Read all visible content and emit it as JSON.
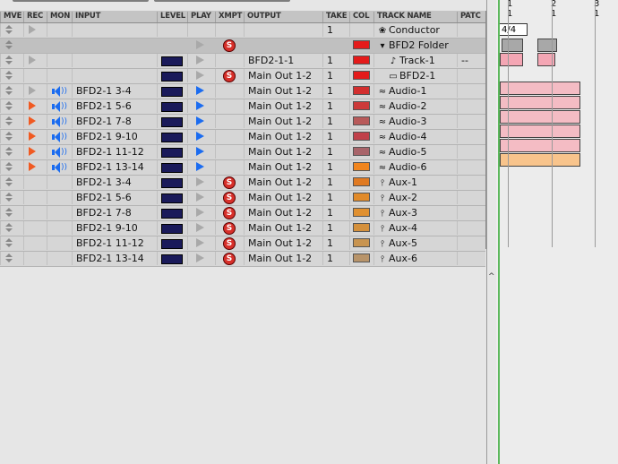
{
  "headers": [
    "MVE",
    "REC",
    "MON",
    "INPUT",
    "LEVEL",
    "PLAY",
    "XMPT",
    "OUTPUT",
    "TAKE",
    "COL",
    "TRACK NAME",
    "PATC"
  ],
  "tracks": [
    {
      "rec": "off",
      "mon": false,
      "input": "",
      "level": false,
      "play": "none",
      "xmpt": false,
      "output": "",
      "take": "1",
      "color": "",
      "icon": "conductor-icon",
      "glyph": "❀",
      "name": "Conductor",
      "patch": "",
      "sel": false
    },
    {
      "rec": "none",
      "mon": false,
      "input": "",
      "level": false,
      "play": "off",
      "xmpt": true,
      "output": "",
      "take": "",
      "color": "#e41b1b",
      "icon": "folder-triangle-icon",
      "glyph": "▾",
      "name": "BFD2 Folder",
      "patch": "",
      "sel": true
    },
    {
      "rec": "off",
      "mon": false,
      "input": "",
      "level": true,
      "play": "off",
      "xmpt": false,
      "output": "BFD2-1-1",
      "take": "1",
      "color": "#e41b1b",
      "icon": "midi-note-icon",
      "glyph": "♪",
      "name": "Track-1",
      "patch": "--",
      "sel": false
    },
    {
      "rec": "none",
      "mon": false,
      "input": "",
      "level": true,
      "play": "off",
      "xmpt": true,
      "output": "Main Out 1-2",
      "take": "1",
      "color": "#e41b1b",
      "icon": "instrument-icon",
      "glyph": "▭",
      "name": "BFD2-1",
      "patch": "",
      "sel": false
    },
    {
      "rec": "off",
      "mon": true,
      "input": "BFD2-1 3-4",
      "level": true,
      "play": "on",
      "xmpt": false,
      "output": "Main Out 1-2",
      "take": "1",
      "color": "#d32f2f",
      "icon": "audio-wave-icon",
      "glyph": "≈",
      "name": "Audio-1",
      "patch": "",
      "sel": false
    },
    {
      "rec": "on",
      "mon": true,
      "input": "BFD2-1 5-6",
      "level": true,
      "play": "on",
      "xmpt": false,
      "output": "Main Out 1-2",
      "take": "1",
      "color": "#cc3a3a",
      "icon": "audio-wave-icon",
      "glyph": "≈",
      "name": "Audio-2",
      "patch": "",
      "sel": false
    },
    {
      "rec": "on",
      "mon": true,
      "input": "BFD2-1 7-8",
      "level": true,
      "play": "on",
      "xmpt": false,
      "output": "Main Out 1-2",
      "take": "1",
      "color": "#b85a5a",
      "icon": "audio-wave-icon",
      "glyph": "≈",
      "name": "Audio-3",
      "patch": "",
      "sel": false
    },
    {
      "rec": "on",
      "mon": true,
      "input": "BFD2-1 9-10",
      "level": true,
      "play": "on",
      "xmpt": false,
      "output": "Main Out 1-2",
      "take": "1",
      "color": "#c0404a",
      "icon": "audio-wave-icon",
      "glyph": "≈",
      "name": "Audio-4",
      "patch": "",
      "sel": false
    },
    {
      "rec": "on",
      "mon": true,
      "input": "BFD2-1 11-12",
      "level": true,
      "play": "on",
      "xmpt": false,
      "output": "Main Out 1-2",
      "take": "1",
      "color": "#a8646a",
      "icon": "audio-wave-icon",
      "glyph": "≈",
      "name": "Audio-5",
      "patch": "",
      "sel": false
    },
    {
      "rec": "on",
      "mon": true,
      "input": "BFD2-1 13-14",
      "level": true,
      "play": "on",
      "xmpt": false,
      "output": "Main Out 1-2",
      "take": "1",
      "color": "#f0851e",
      "icon": "audio-wave-icon",
      "glyph": "≈",
      "name": "Audio-6",
      "patch": "",
      "sel": false
    },
    {
      "rec": "none",
      "mon": false,
      "input": "BFD2-1 3-4",
      "level": true,
      "play": "off",
      "xmpt": true,
      "output": "Main Out 1-2",
      "take": "1",
      "color": "#e07a22",
      "icon": "aux-icon",
      "glyph": "⫯",
      "name": "Aux-1",
      "patch": "",
      "sel": false
    },
    {
      "rec": "none",
      "mon": false,
      "input": "BFD2-1 5-6",
      "level": true,
      "play": "off",
      "xmpt": true,
      "output": "Main Out 1-2",
      "take": "1",
      "color": "#e08a2a",
      "icon": "aux-icon",
      "glyph": "⫯",
      "name": "Aux-2",
      "patch": "",
      "sel": false
    },
    {
      "rec": "none",
      "mon": false,
      "input": "BFD2-1 7-8",
      "level": true,
      "play": "off",
      "xmpt": true,
      "output": "Main Out 1-2",
      "take": "1",
      "color": "#e09030",
      "icon": "aux-icon",
      "glyph": "⫯",
      "name": "Aux-3",
      "patch": "",
      "sel": false
    },
    {
      "rec": "none",
      "mon": false,
      "input": "BFD2-1 9-10",
      "level": true,
      "play": "off",
      "xmpt": true,
      "output": "Main Out 1-2",
      "take": "1",
      "color": "#d4903c",
      "icon": "aux-icon",
      "glyph": "⫯",
      "name": "Aux-4",
      "patch": "",
      "sel": false
    },
    {
      "rec": "none",
      "mon": false,
      "input": "BFD2-1 11-12",
      "level": true,
      "play": "off",
      "xmpt": true,
      "output": "Main Out 1-2",
      "take": "1",
      "color": "#c89450",
      "icon": "aux-icon",
      "glyph": "⫯",
      "name": "Aux-5",
      "patch": "",
      "sel": false
    },
    {
      "rec": "none",
      "mon": false,
      "input": "BFD2-1 13-14",
      "level": true,
      "play": "off",
      "xmpt": true,
      "output": "Main Out 1-2",
      "take": "1",
      "color": "#b8946a",
      "icon": "aux-icon",
      "glyph": "⫯",
      "name": "Aux-6",
      "patch": "",
      "sel": false
    }
  ],
  "timeline": {
    "ruler": [
      {
        "bar": "1",
        "beat": "1"
      },
      {
        "bar": "2",
        "beat": "1"
      },
      {
        "bar": "3",
        "beat": "1"
      }
    ],
    "time_signature": "4/4",
    "split_caret": "^"
  }
}
